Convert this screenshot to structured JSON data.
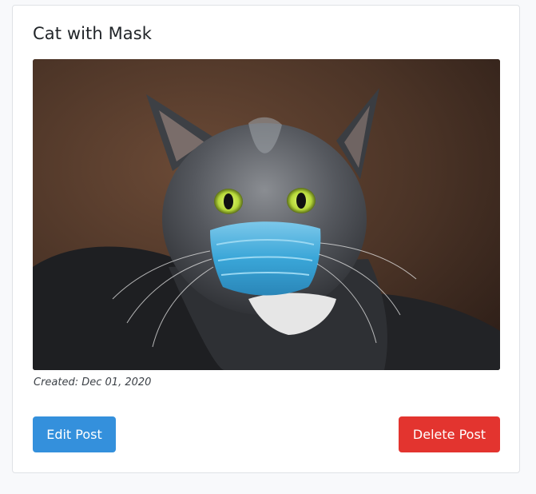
{
  "post": {
    "title": "Cat with Mask",
    "image_alt": "Cat wearing a blue surgical face mask",
    "created_label": "Created: Dec 01, 2020"
  },
  "actions": {
    "edit_label": "Edit Post",
    "delete_label": "Delete Post"
  },
  "colors": {
    "edit_button": "#3490dc",
    "delete_button": "#e3342f",
    "page_background": "#f8f9fb",
    "card_border": "#dfe2e6"
  }
}
